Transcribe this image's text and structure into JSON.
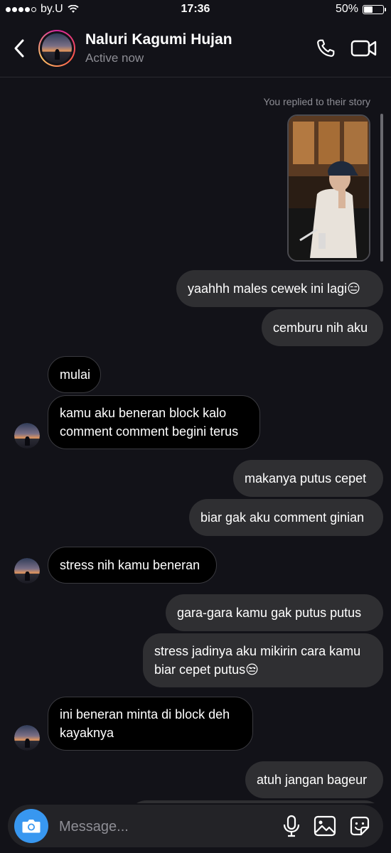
{
  "status_bar": {
    "carrier": "by.U",
    "time": "17:36",
    "battery": "50%",
    "battery_level": 0.5
  },
  "header": {
    "contact_name": "Naluri Kagumi Hujan",
    "contact_status": "Active now"
  },
  "thread": {
    "story_label": "You replied to their story",
    "messages": [
      {
        "from": "me",
        "text": "yaahhh males cewek ini lagi😑"
      },
      {
        "from": "me",
        "text": "cemburu nih aku"
      },
      {
        "from": "them",
        "text": "mulai"
      },
      {
        "from": "them",
        "text": "kamu aku beneran block kalo comment comment begini terus"
      },
      {
        "from": "me",
        "text": "makanya putus cepet"
      },
      {
        "from": "me",
        "text": "biar gak aku comment ginian"
      },
      {
        "from": "them",
        "text": "stress nih kamu beneran"
      },
      {
        "from": "me",
        "text": "gara-gara kamu gak putus putus"
      },
      {
        "from": "me",
        "text": "stress jadinya aku mikirin cara kamu biar cepet putus😒"
      },
      {
        "from": "them",
        "text": "ini beneran minta di block deh kayaknya"
      },
      {
        "from": "me",
        "text": "atuh jangan bageur"
      }
    ]
  },
  "composer": {
    "placeholder": "Message..."
  },
  "icons": {
    "back": "chevron-left-icon",
    "call": "phone-icon",
    "video": "video-camera-icon",
    "camera": "camera-icon",
    "mic": "microphone-icon",
    "gallery": "image-icon",
    "sticker": "sticker-icon"
  },
  "colors": {
    "background": "#121218",
    "outgoing_bubble": "#2f2f32",
    "incoming_bubble": "#000000",
    "accent": "#3897f0"
  }
}
